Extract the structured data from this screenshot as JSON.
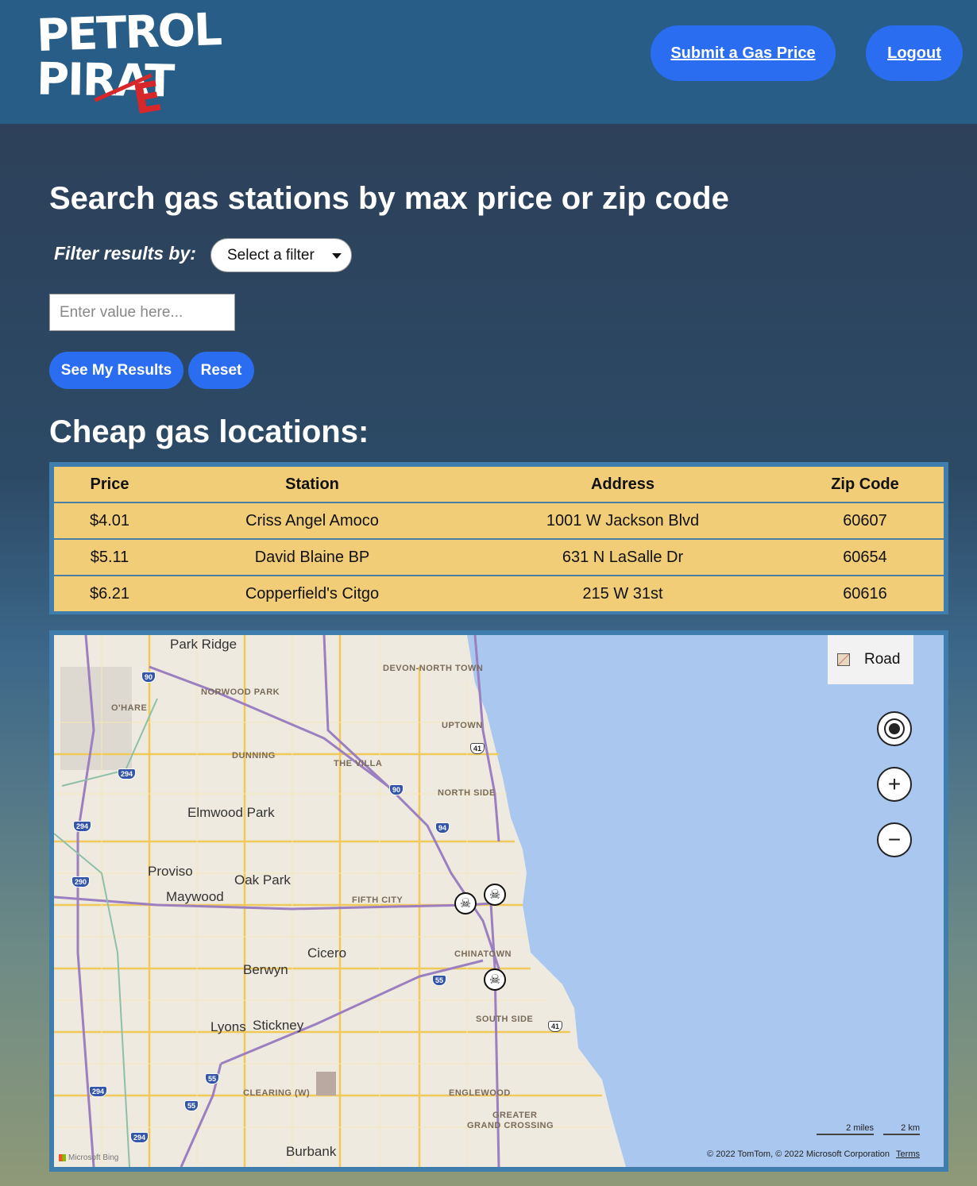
{
  "header": {
    "logo_line1": "PETROL",
    "logo_line2": "PIRAT",
    "logo_accent": "E",
    "submit_label": "Submit a Gas Price",
    "logout_label": "Logout"
  },
  "search": {
    "heading": "Search gas stations by max price or zip code",
    "filter_label": "Filter results by:",
    "filter_select": "Select a filter",
    "input_placeholder": "Enter value here...",
    "see_results": "See My Results",
    "reset": "Reset"
  },
  "results": {
    "heading": "Cheap gas locations:",
    "columns": [
      "Price",
      "Station",
      "Address",
      "Zip Code"
    ],
    "rows": [
      [
        "$4.01",
        "Criss Angel Amoco",
        "1001 W Jackson Blvd",
        "60607"
      ],
      [
        "$5.11",
        "David Blaine BP",
        "631 N LaSalle Dr",
        "60654"
      ],
      [
        "$6.21",
        "Copperfield's Citgo",
        "215 W 31st",
        "60616"
      ]
    ]
  },
  "map": {
    "style_label": "Road",
    "places": {
      "park_ridge": "Park Ridge",
      "elmwood_park": "Elmwood Park",
      "proviso": "Proviso",
      "maywood": "Maywood",
      "oak_park": "Oak Park",
      "cicero": "Cicero",
      "berwyn": "Berwyn",
      "lyons": "Lyons",
      "stickney": "Stickney",
      "burbank": "Burbank"
    },
    "districts": {
      "devon": "DEVON-NORTH TOWN",
      "norwood": "NORWOOD PARK",
      "ohare": "O'HARE",
      "uptown": "UPTOWN",
      "dunning": "DUNNING",
      "villa": "THE VILLA",
      "northside": "NORTH SIDE",
      "fifthcity": "FIFTH CITY",
      "chinatown": "CHINATOWN",
      "southside": "SOUTH SIDE",
      "clearing": "CLEARING (W)",
      "englewood": "ENGLEWOOD",
      "greater1": "GREATER",
      "greater2": "GRAND CROSSING"
    },
    "shields": {
      "s90a": "90",
      "s294a": "294",
      "s294b": "294",
      "s290": "290",
      "s90b": "90",
      "s94": "94",
      "s41a": "41",
      "s55a": "55",
      "s41b": "41",
      "s55b": "55",
      "s294c": "294",
      "s55c": "55",
      "s294d": "294"
    },
    "scale_miles": "2 miles",
    "scale_km": "2 km",
    "copyright": "© 2022 TomTom, © 2022 Microsoft Corporation",
    "terms": "Terms",
    "bing": "Microsoft Bing",
    "colors": {
      "water": "#a9c7ef",
      "land": "#eeeadf",
      "highway": "#9b7fc0",
      "arterial": "#f0c95a"
    }
  }
}
